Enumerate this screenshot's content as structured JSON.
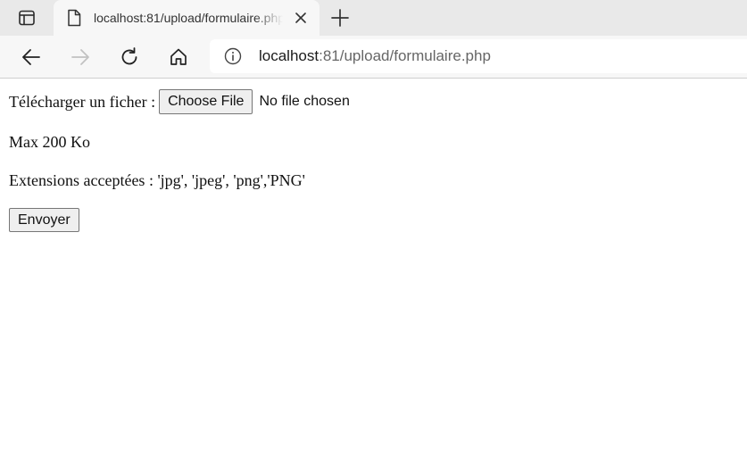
{
  "browser": {
    "tab": {
      "title": "localhost:81/upload/formulaire.php",
      "favicon": "page-icon"
    },
    "toolbar": {
      "back_icon": "back-arrow-icon",
      "forward_icon": "forward-arrow-icon",
      "reload_icon": "reload-icon",
      "home_icon": "home-icon"
    },
    "address": {
      "host": "localhost",
      "rest": ":81/upload/formulaire.php",
      "info_icon": "info-icon"
    }
  },
  "form": {
    "upload_label": "Télécharger un ficher :",
    "choose_file_label": "Choose File",
    "file_status": "No file chosen",
    "max_size_text": "Max 200 Ko",
    "extensions_text": "Extensions acceptées : 'jpg', 'jpeg', 'png','PNG'",
    "submit_label": "Envoyer"
  },
  "colors": {
    "tabstrip": "#e9e9e9",
    "toolbar": "#f7f7f7",
    "button_bg": "#efefef"
  }
}
